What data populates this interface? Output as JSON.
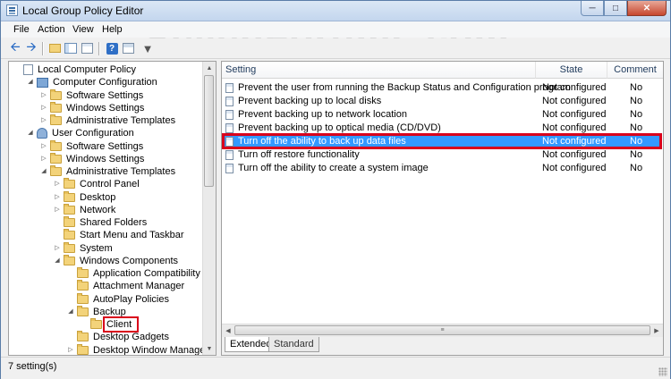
{
  "window": {
    "title": "Local Group Policy Editor"
  },
  "watermark": "SevenForums.com",
  "menu": {
    "file": "File",
    "action": "Action",
    "view": "View",
    "help": "Help"
  },
  "toolbar": {
    "icons": [
      "back-icon",
      "forward-icon",
      "up-folder-icon",
      "show-hide-tree-icon",
      "export-list-icon",
      "help-icon",
      "properties-icon",
      "filter-icon"
    ]
  },
  "tree": {
    "items": [
      {
        "label": "Local Computer Policy",
        "level": 0,
        "expander": "",
        "icon": "doc-icon"
      },
      {
        "label": "Computer Configuration",
        "level": 1,
        "expander": "◢",
        "icon": "computer-icon"
      },
      {
        "label": "Software Settings",
        "level": 2,
        "expander": "▷",
        "icon": "folder-icon"
      },
      {
        "label": "Windows Settings",
        "level": 2,
        "expander": "▷",
        "icon": "folder-icon"
      },
      {
        "label": "Administrative Templates",
        "level": 2,
        "expander": "▷",
        "icon": "folder-icon"
      },
      {
        "label": "User Configuration",
        "level": 1,
        "expander": "◢",
        "icon": "user-icon"
      },
      {
        "label": "Software Settings",
        "level": 2,
        "expander": "▷",
        "icon": "folder-icon"
      },
      {
        "label": "Windows Settings",
        "level": 2,
        "expander": "▷",
        "icon": "folder-icon"
      },
      {
        "label": "Administrative Templates",
        "level": 2,
        "expander": "◢",
        "icon": "folder-icon"
      },
      {
        "label": "Control Panel",
        "level": 3,
        "expander": "▷",
        "icon": "folder-icon"
      },
      {
        "label": "Desktop",
        "level": 3,
        "expander": "▷",
        "icon": "folder-icon"
      },
      {
        "label": "Network",
        "level": 3,
        "expander": "▷",
        "icon": "folder-icon"
      },
      {
        "label": "Shared Folders",
        "level": 3,
        "expander": "",
        "icon": "folder-icon"
      },
      {
        "label": "Start Menu and Taskbar",
        "level": 3,
        "expander": "",
        "icon": "folder-icon"
      },
      {
        "label": "System",
        "level": 3,
        "expander": "▷",
        "icon": "folder-icon"
      },
      {
        "label": "Windows Components",
        "level": 3,
        "expander": "◢",
        "icon": "folder-icon"
      },
      {
        "label": "Application Compatibility",
        "level": 4,
        "expander": "",
        "icon": "folder-icon"
      },
      {
        "label": "Attachment Manager",
        "level": 4,
        "expander": "",
        "icon": "folder-icon"
      },
      {
        "label": "AutoPlay Policies",
        "level": 4,
        "expander": "",
        "icon": "folder-icon"
      },
      {
        "label": "Backup",
        "level": 4,
        "expander": "◢",
        "icon": "folder-icon"
      },
      {
        "label": "Client",
        "level": 5,
        "expander": "",
        "icon": "folder-icon",
        "highlighted": true
      },
      {
        "label": "Desktop Gadgets",
        "level": 4,
        "expander": "",
        "icon": "folder-icon"
      },
      {
        "label": "Desktop Window Manager",
        "level": 4,
        "expander": "▷",
        "icon": "folder-icon"
      }
    ]
  },
  "policies": {
    "columns": {
      "setting": "Setting",
      "state": "State",
      "comment": "Comment"
    },
    "rows": [
      {
        "setting": "Prevent the user from running the Backup Status and Configuration program",
        "state": "Not configured",
        "comment": "No"
      },
      {
        "setting": "Prevent backing up to local disks",
        "state": "Not configured",
        "comment": "No"
      },
      {
        "setting": "Prevent backing up to network location",
        "state": "Not configured",
        "comment": "No"
      },
      {
        "setting": "Prevent backing up to optical media (CD/DVD)",
        "state": "Not configured",
        "comment": "No"
      },
      {
        "setting": "Turn off the ability to back up data files",
        "state": "Not configured",
        "comment": "No",
        "selected": true
      },
      {
        "setting": "Turn off restore functionality",
        "state": "Not configured",
        "comment": "No"
      },
      {
        "setting": "Turn off the ability to create a system image",
        "state": "Not configured",
        "comment": "No"
      }
    ]
  },
  "tabs": {
    "extended": "Extended",
    "standard": "Standard"
  },
  "status": {
    "text": "7 setting(s)"
  },
  "colors": {
    "selection": "#3399ff",
    "highlight_outline": "#d9001b"
  }
}
